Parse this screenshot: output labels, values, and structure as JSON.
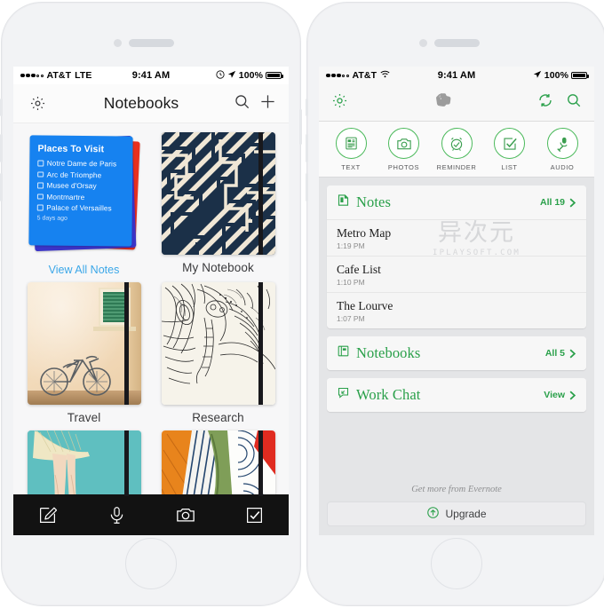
{
  "left_phone": {
    "status_bar": {
      "carrier": "AT&T",
      "network": "LTE",
      "time": "9:41 AM",
      "battery_pct": "100%"
    },
    "nav": {
      "title": "Notebooks",
      "settings_icon": "gear-icon",
      "search_icon": "search-icon",
      "add_icon": "plus-icon"
    },
    "note_card": {
      "title": "Places To Visit",
      "items": [
        "Notre Dame de Paris",
        "Arc de Triomphe",
        "Musee d'Orsay",
        "Montmartre",
        "Palace of Versailles"
      ],
      "timestamp": "5 days ago",
      "view_all_label": "View All Notes",
      "top_color": "#1682f0",
      "mid_color": "#3b34c8",
      "back_color": "#e8301f",
      "link_color": "#3ba7e8"
    },
    "notebooks": [
      {
        "label": "My Notebook",
        "cover": "navy-maze-pattern"
      },
      {
        "label": "Travel",
        "cover": "bicycle-green-shutters"
      },
      {
        "label": "Research",
        "cover": "elephant-linework"
      },
      {
        "label": "",
        "cover": "teal-ballerina"
      },
      {
        "label": "",
        "cover": "orange-green-red-abstract"
      }
    ],
    "toolbar": [
      {
        "name": "compose-icon",
        "label": "Compose"
      },
      {
        "name": "microphone-icon",
        "label": "Audio"
      },
      {
        "name": "camera-icon",
        "label": "Camera"
      },
      {
        "name": "checklist-icon",
        "label": "Checklist"
      }
    ]
  },
  "right_phone": {
    "status_bar": {
      "carrier": "AT&T",
      "network": "wifi",
      "time": "9:41 AM",
      "battery_pct": "100%"
    },
    "nav": {
      "settings_icon": "gear-icon",
      "logo_icon": "evernote-elephant-icon",
      "sync_icon": "sync-icon",
      "search_icon": "search-icon"
    },
    "quick_actions": [
      {
        "label": "TEXT",
        "icon": "text-note-icon"
      },
      {
        "label": "PHOTOS",
        "icon": "camera-icon"
      },
      {
        "label": "REMINDER",
        "icon": "alarm-clock-icon"
      },
      {
        "label": "LIST",
        "icon": "checkbox-icon"
      },
      {
        "label": "AUDIO",
        "icon": "microphone-icon"
      }
    ],
    "sections": [
      {
        "title": "Notes",
        "icon": "note-page-icon",
        "action": "All 19",
        "rows": [
          {
            "name": "Metro Map",
            "time": "1:19 PM"
          },
          {
            "name": "Cafe List",
            "time": "1:10 PM"
          },
          {
            "name": "The Lourve",
            "time": "1:07 PM"
          }
        ]
      },
      {
        "title": "Notebooks",
        "icon": "notebook-icon",
        "action": "All 5",
        "rows": []
      },
      {
        "title": "Work Chat",
        "icon": "work-chat-icon",
        "action": "View",
        "rows": []
      }
    ],
    "footer": {
      "tagline": "Get more from Evernote",
      "upgrade_label": "Upgrade",
      "upgrade_icon": "up-arrow-circle-icon"
    },
    "accent_color": "#2aa04a"
  },
  "watermark": {
    "primary": "异次元",
    "secondary": "IPLAYSOFT.COM"
  }
}
